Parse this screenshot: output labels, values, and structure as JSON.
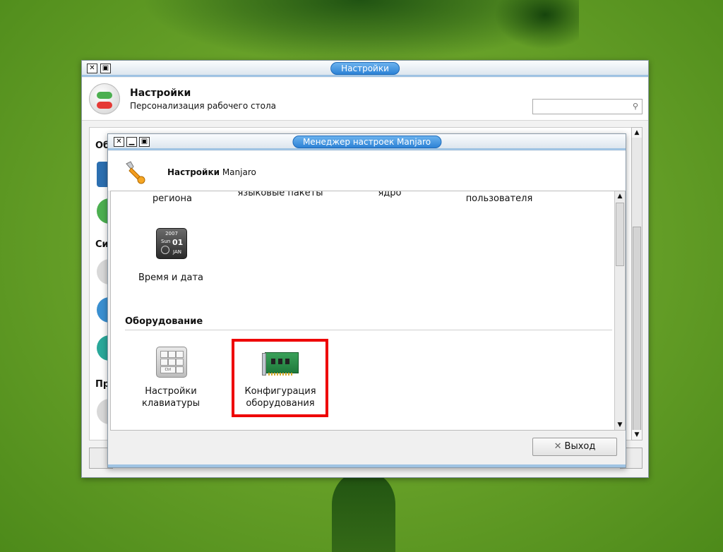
{
  "back_window": {
    "title": "Настройки",
    "header_title": "Настройки",
    "header_subtitle": "Персонализация рабочего стола",
    "search_placeholder": "",
    "partial_labels": [
      "Обо",
      "Си",
      "Пр"
    ]
  },
  "front_window": {
    "title": "Менеджер настроек Manjaro",
    "header_title_bold": "Настройки",
    "header_title_rest": " Manjaro",
    "top_row_partial": [
      "региона",
      "языковые пакеты",
      "ядро",
      "пользователя"
    ],
    "items": [
      {
        "label": "Время и дата",
        "icon": "calendar-icon"
      }
    ],
    "calendar_icon_text": {
      "year": "2007",
      "weekday": "Sun",
      "day": "01",
      "month": "JAN"
    },
    "keyboard_keys": [
      "Ctrl"
    ],
    "section": {
      "title": "Оборудование",
      "items": [
        {
          "label_line1": "Настройки",
          "label_line2": "клавиатуры",
          "icon": "keyboard-icon"
        },
        {
          "label_line1": "Конфигурация",
          "label_line2": "оборудования",
          "icon": "hardware-card-icon",
          "highlighted": true
        }
      ]
    },
    "exit_label": "Выход"
  },
  "colors": {
    "title_pill": "#2d82d6",
    "highlight": "#ee0000",
    "wallpaper": "#6aa32a"
  }
}
